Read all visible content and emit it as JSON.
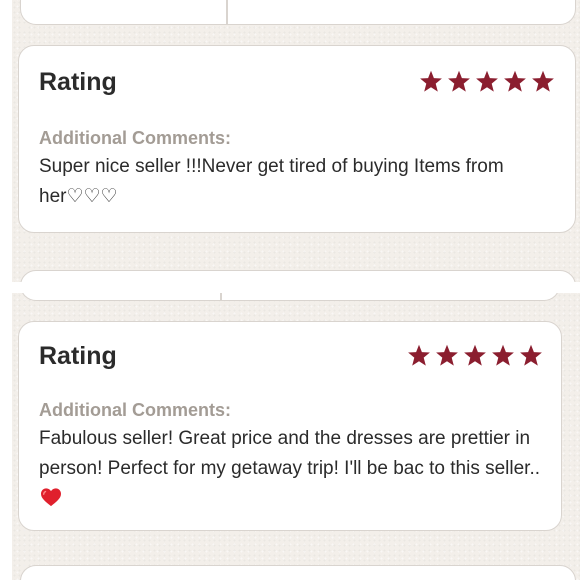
{
  "colors": {
    "star": "#8b1e2f",
    "heart": "#e0202d",
    "label": "#a39c95"
  },
  "reviews": [
    {
      "title": "Rating",
      "stars": 5,
      "comments_label": "Additional Comments:",
      "comment": "Super nice seller !!!Never get tired of buying Items from her♡♡♡",
      "emoji": ""
    },
    {
      "title": "Rating",
      "stars": 5,
      "comments_label": "Additional Comments:",
      "comment": "Fabulous seller! Great price and the dresses are prettier in person! Perfect for my getaway trip! I'll be bac to this seller..",
      "emoji": "heart-emoji"
    }
  ]
}
